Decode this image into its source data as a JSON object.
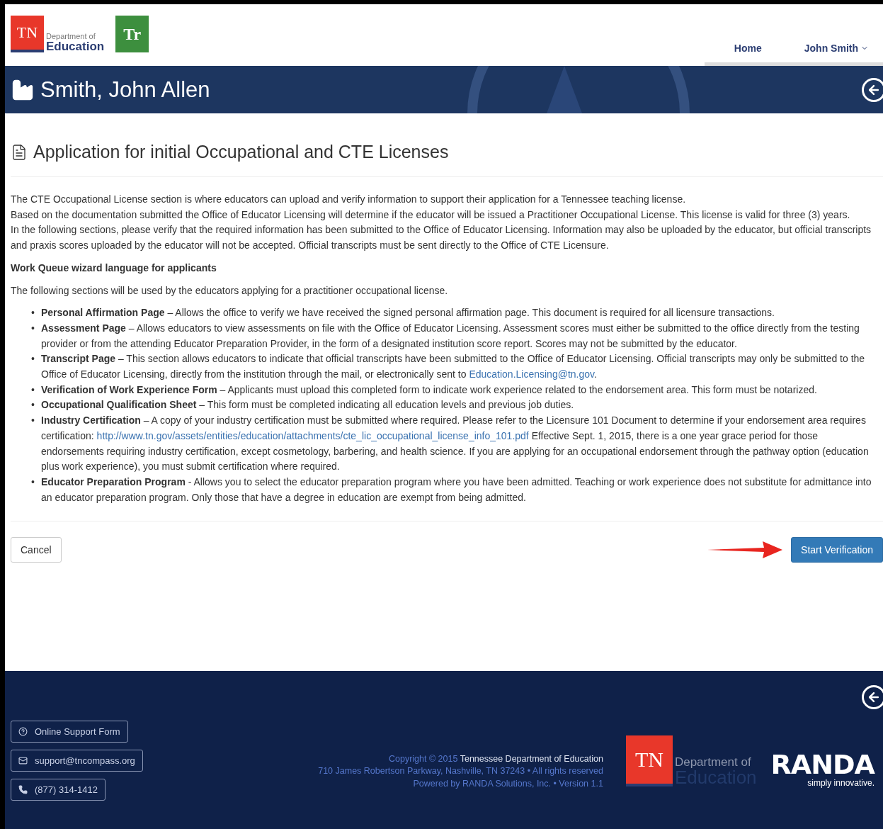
{
  "header": {
    "logo": {
      "mark": "TN",
      "line1": "Department of",
      "line2": "Education"
    },
    "app_logo": "Tr",
    "nav": [
      {
        "label": "Home",
        "kind": "link"
      },
      {
        "label": "John Smith",
        "kind": "dropdown"
      }
    ]
  },
  "banner": {
    "title": "Smith, John Allen"
  },
  "page": {
    "title": "Application for initial Occupational and CTE Licenses",
    "intro": [
      "The CTE Occupational License section is where educators can upload and verify information to support their application for a Tennessee teaching license.",
      "Based on the documentation submitted the Office of Educator Licensing will determine if the educator will be issued a Practitioner Occupational License. This license is valid for three (3) years.",
      "In the following sections, please verify that the required information has been submitted to the Office of Educator Licensing. Information may also be uploaded by the educator, but official transcripts and praxis scores uploaded by the educator will not be accepted. Official transcripts must be sent directly to the Office of CTE Licensure."
    ],
    "subheading": "Work Queue wizard language for applicants",
    "bullet": "•",
    "lead": "The following sections will be used by the educators applying for a practitioner occupational license.",
    "items": [
      {
        "term": "Personal Affirmation Page",
        "text": " – Allows the office to verify we have received the signed personal affirmation page. This document is required for all licensure transactions."
      },
      {
        "term": "Assessment Page",
        "text": " – Allows educators to view assessments on file with the Office of Educator Licensing. Assessment scores must either be submitted to the office directly from the testing provider or from the attending Educator Preparation Provider, in the form of a designated institution score report. Scores may not be submitted by the educator."
      },
      {
        "term": "Transcript Page",
        "text": " – This section allows educators to indicate that official transcripts have been submitted to the Office of Educator Licensing. Official transcripts may only be submitted to the Office of Educator Licensing, directly from the institution through the mail, or electronically sent to ",
        "link": "Education.Licensing@tn.gov",
        "after": "."
      },
      {
        "term": "Verification of Work Experience Form",
        "text": " – Applicants must upload this completed form to indicate work experience related to the endorsement area. This form must be notarized."
      },
      {
        "term": "Occupational Qualification Sheet",
        "text": " – This form must be completed indicating all education levels and previous job duties."
      },
      {
        "term": "Industry Certification",
        "text": " – A copy of your industry certification must be submitted where required. Please refer to the Licensure 101 Document to determine if your endorsement area requires certification: ",
        "link": "http://www.tn.gov/assets/entities/education/attachments/cte_lic_occupational_license_info_101.pdf",
        "after": " Effective Sept. 1, 2015, there is a one year grace period for those endorsements requiring industry certification, except cosmetology, barbering, and health science. If you are applying for an occupational endorsement through the pathway option (education plus work experience), you must submit certification where required."
      },
      {
        "term": "Educator Preparation Program",
        "text": " - Allows you to select the educator preparation program where you have been admitted. Teaching or work experience does not substitute for admittance into an educator preparation program. Only those that have a degree in education are exempt from being admitted."
      }
    ],
    "cancel": "Cancel",
    "start": "Start Verification"
  },
  "footer": {
    "buttons": [
      {
        "label": "Online Support Form",
        "kind": "help"
      },
      {
        "label": "support@tncompass.org",
        "kind": "email"
      },
      {
        "label": "(877) 314-1412",
        "kind": "phone"
      }
    ],
    "copyright": "Copyright © 2015",
    "org": "Tennessee Department of Education",
    "address": "710 James Robertson Parkway, Nashville, TN 37243 • All rights reserved",
    "powered": "Powered by RANDA Solutions, Inc. • Version 1.1",
    "logo": {
      "mark": "TN",
      "line1": "Department of",
      "line2": "Education"
    },
    "randa": {
      "name": "RANDA",
      "tagline": "simply innovative."
    }
  }
}
